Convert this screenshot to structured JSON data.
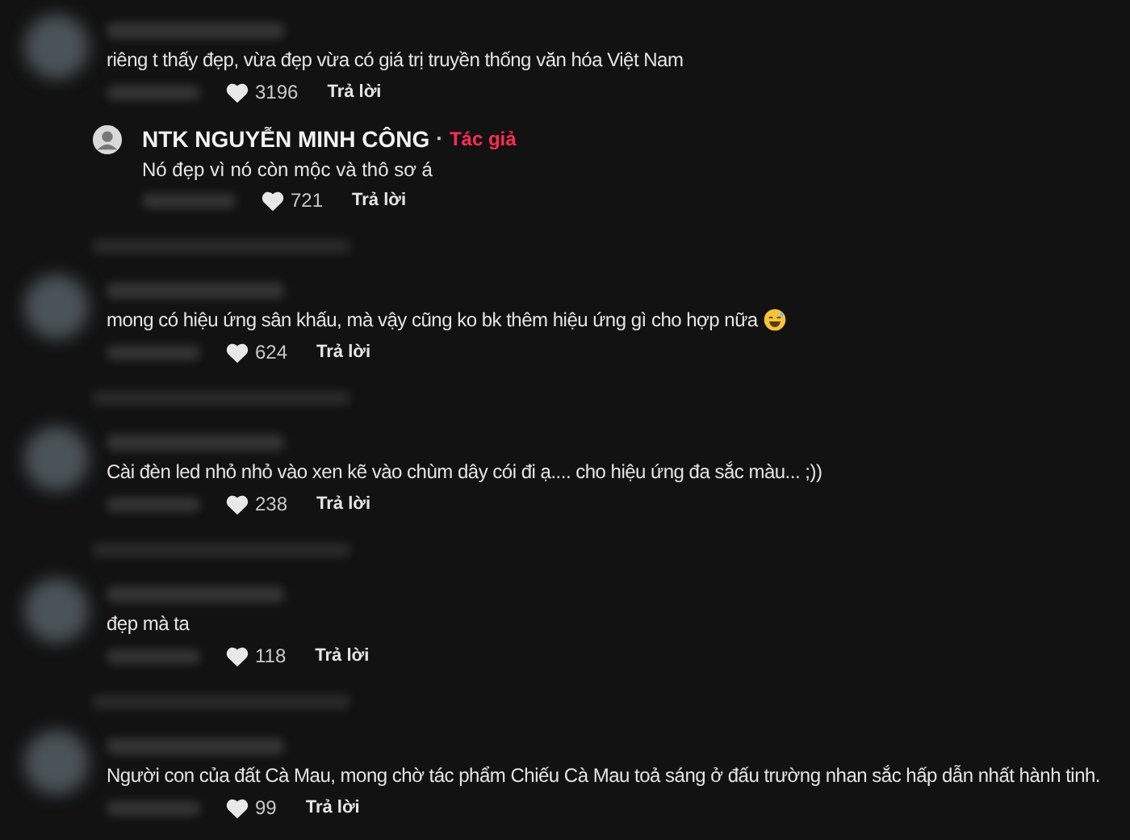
{
  "comments": [
    {
      "text": "riêng t thấy đẹp, vừa đẹp vừa có giá trị truyền thống văn hóa Việt Nam",
      "likes": "3196",
      "reply_label": "Trả lời",
      "replies": [
        {
          "author": "NTK NGUYỄN MINH CÔNG",
          "separator": "·",
          "badge": "Tác giả",
          "text": "Nó đẹp vì nó còn mộc và thô sơ á",
          "likes": "721",
          "reply_label": "Trả lời"
        }
      ]
    },
    {
      "text": "mong có hiệu ứng sân khấu, mà vậy cũng ko bk thêm hiệu ứng gì cho hợp nữa",
      "sweat_smile_emoji": true,
      "likes": "624",
      "reply_label": "Trả lời"
    },
    {
      "text": "Cài đèn led nhỏ nhỏ vào xen kẽ vào chùm dây cói đi ạ.... cho hiệu ứng đa sắc màu... ;))",
      "likes": "238",
      "reply_label": "Trả lời"
    },
    {
      "text": "đẹp mà ta",
      "likes": "118",
      "reply_label": "Trả lời"
    },
    {
      "text": "Người con của đất Cà Mau, mong chờ tác phẩm Chiếu Cà Mau toả sáng ở đấu trường nhan sắc hấp dẫn nhất hành tinh.",
      "likes": "99",
      "reply_label": "Trả lời"
    }
  ]
}
